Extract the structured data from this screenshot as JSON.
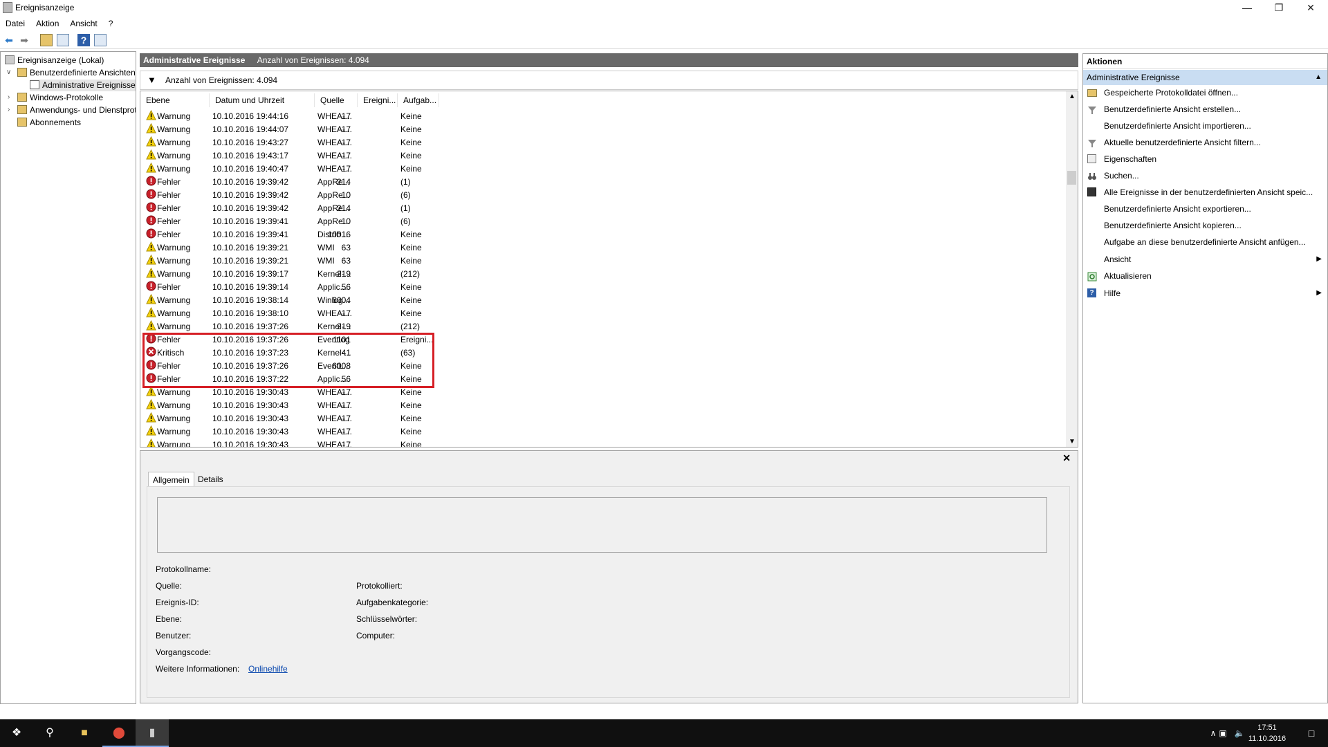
{
  "window": {
    "title": "Ereignisanzeige"
  },
  "menu": [
    "Datei",
    "Aktion",
    "Ansicht",
    "?"
  ],
  "tree": {
    "root": "Ereignisanzeige (Lokal)",
    "custom_views": "Benutzerdefinierte Ansichten",
    "admin_events": "Administrative Ereignisse",
    "windows_logs": "Windows-Protokolle",
    "app_logs": "Anwendungs- und Dienstprotokolle",
    "subscriptions": "Abonnements"
  },
  "center": {
    "header_title": "Administrative Ereignisse",
    "header_count": "Anzahl von Ereignissen: 4.094",
    "filter_text": "Anzahl von Ereignissen: 4.094",
    "columns": [
      "Ebene",
      "Datum und Uhrzeit",
      "Quelle",
      "Ereigni...",
      "Aufgab..."
    ],
    "rows": [
      [
        "Warnung",
        "10.10.2016 19:44:16",
        "WHEA-...",
        "17",
        "Keine"
      ],
      [
        "Warnung",
        "10.10.2016 19:44:07",
        "WHEA-...",
        "17",
        "Keine"
      ],
      [
        "Warnung",
        "10.10.2016 19:43:27",
        "WHEA-...",
        "17",
        "Keine"
      ],
      [
        "Warnung",
        "10.10.2016 19:43:17",
        "WHEA-...",
        "17",
        "Keine"
      ],
      [
        "Warnung",
        "10.10.2016 19:40:47",
        "WHEA-...",
        "17",
        "Keine"
      ],
      [
        "Fehler",
        "10.10.2016 19:39:42",
        "AppRe...",
        "214",
        "(1)"
      ],
      [
        "Fehler",
        "10.10.2016 19:39:42",
        "AppRe...",
        "10",
        "(6)"
      ],
      [
        "Fehler",
        "10.10.2016 19:39:42",
        "AppRe...",
        "214",
        "(1)"
      ],
      [
        "Fehler",
        "10.10.2016 19:39:41",
        "AppRe...",
        "10",
        "(6)"
      ],
      [
        "Fehler",
        "10.10.2016 19:39:41",
        "Distrib...",
        "10016",
        "Keine"
      ],
      [
        "Warnung",
        "10.10.2016 19:39:21",
        "WMI",
        "63",
        "Keine"
      ],
      [
        "Warnung",
        "10.10.2016 19:39:21",
        "WMI",
        "63",
        "Keine"
      ],
      [
        "Warnung",
        "10.10.2016 19:39:17",
        "Kernel-...",
        "219",
        "(212)"
      ],
      [
        "Fehler",
        "10.10.2016 19:39:14",
        "Applic...",
        "56",
        "Keine"
      ],
      [
        "Warnung",
        "10.10.2016 19:38:14",
        "Winlog...",
        "6004",
        "Keine"
      ],
      [
        "Warnung",
        "10.10.2016 19:38:10",
        "WHEA-...",
        "17",
        "Keine"
      ],
      [
        "Warnung",
        "10.10.2016 19:37:26",
        "Kernel-...",
        "219",
        "(212)"
      ],
      [
        "Fehler",
        "10.10.2016 19:37:26",
        "Eventlog",
        "1101",
        "Ereigni..."
      ],
      [
        "Kritisch",
        "10.10.2016 19:37:23",
        "Kernel-...",
        "41",
        "(63)"
      ],
      [
        "Fehler",
        "10.10.2016 19:37:26",
        "EventL...",
        "6008",
        "Keine"
      ],
      [
        "Fehler",
        "10.10.2016 19:37:22",
        "Applic...",
        "56",
        "Keine"
      ],
      [
        "Warnung",
        "10.10.2016 19:30:43",
        "WHEA-...",
        "17",
        "Keine"
      ],
      [
        "Warnung",
        "10.10.2016 19:30:43",
        "WHEA-...",
        "17",
        "Keine"
      ],
      [
        "Warnung",
        "10.10.2016 19:30:43",
        "WHEA-...",
        "17",
        "Keine"
      ],
      [
        "Warnung",
        "10.10.2016 19:30:43",
        "WHEA-...",
        "17",
        "Keine"
      ],
      [
        "Warnung",
        "10.10.2016 19:30:43",
        "WHEA-...",
        "17",
        "Keine"
      ]
    ]
  },
  "detail": {
    "tabs": [
      "Allgemein",
      "Details"
    ],
    "labels": {
      "protokollname": "Protokollname:",
      "quelle": "Quelle:",
      "protokolliert": "Protokolliert:",
      "ereignis_id": "Ereignis-ID:",
      "aufgabenkategorie": "Aufgabenkategorie:",
      "ebene": "Ebene:",
      "schluesselwoerter": "Schlüsselwörter:",
      "benutzer": "Benutzer:",
      "computer": "Computer:",
      "vorgangscode": "Vorgangscode:",
      "weitere": "Weitere Informationen:",
      "onlinehilfe": "Onlinehilfe"
    }
  },
  "actions": {
    "header": "Aktionen",
    "section": "Administrative Ereignisse",
    "items": [
      {
        "label": "Gespeicherte Protokolldatei öffnen...",
        "icon": "folder-open-icon"
      },
      {
        "label": "Benutzerdefinierte Ansicht erstellen...",
        "icon": "filter-icon"
      },
      {
        "label": "Benutzerdefinierte Ansicht importieren...",
        "icon": ""
      },
      {
        "label": "Aktuelle benutzerdefinierte Ansicht filtern...",
        "icon": "filter-icon"
      },
      {
        "label": "Eigenschaften",
        "icon": "properties-icon"
      },
      {
        "label": "Suchen...",
        "icon": "binoculars-icon"
      },
      {
        "label": "Alle Ereignisse in der benutzerdefinierten Ansicht speic...",
        "icon": "save-icon"
      },
      {
        "label": "Benutzerdefinierte Ansicht exportieren...",
        "icon": ""
      },
      {
        "label": "Benutzerdefinierte Ansicht kopieren...",
        "icon": ""
      },
      {
        "label": "Aufgabe an diese benutzerdefinierte Ansicht anfügen...",
        "icon": ""
      },
      {
        "label": "Ansicht",
        "icon": ""
      },
      {
        "label": "Aktualisieren",
        "icon": "refresh-icon"
      },
      {
        "label": "Hilfe",
        "icon": "help-icon"
      }
    ]
  },
  "taskbar": {
    "time": "17:51",
    "date": "11.10.2016"
  }
}
